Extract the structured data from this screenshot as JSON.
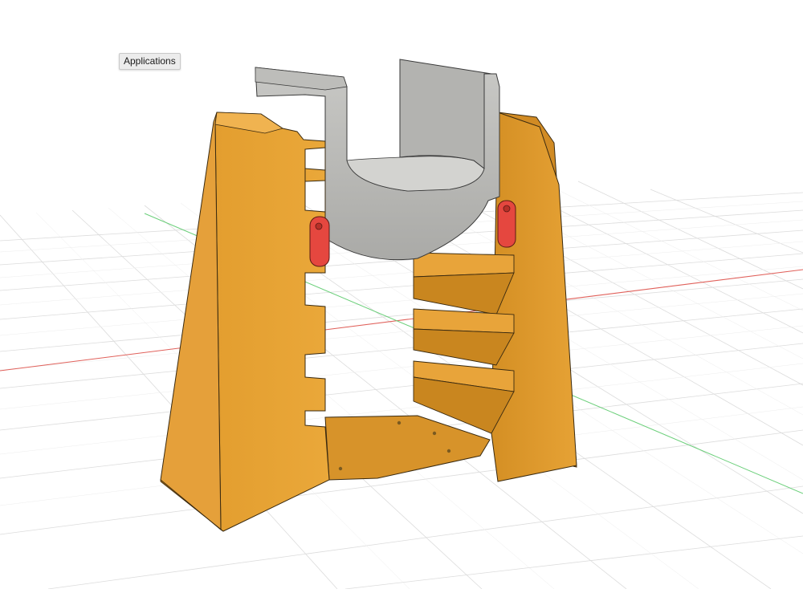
{
  "tooltip": {
    "text": "Applications"
  },
  "canvas": {
    "background": "#ffffff",
    "grid_color": "#d9d9d9",
    "x_axis_color": "#e0605a",
    "y_axis_color": "#6bcf7a",
    "body_color": "#e8a336",
    "body_dark": "#c9861f",
    "insert_color": "#b9b9b6",
    "latch_color": "#e5473f"
  }
}
